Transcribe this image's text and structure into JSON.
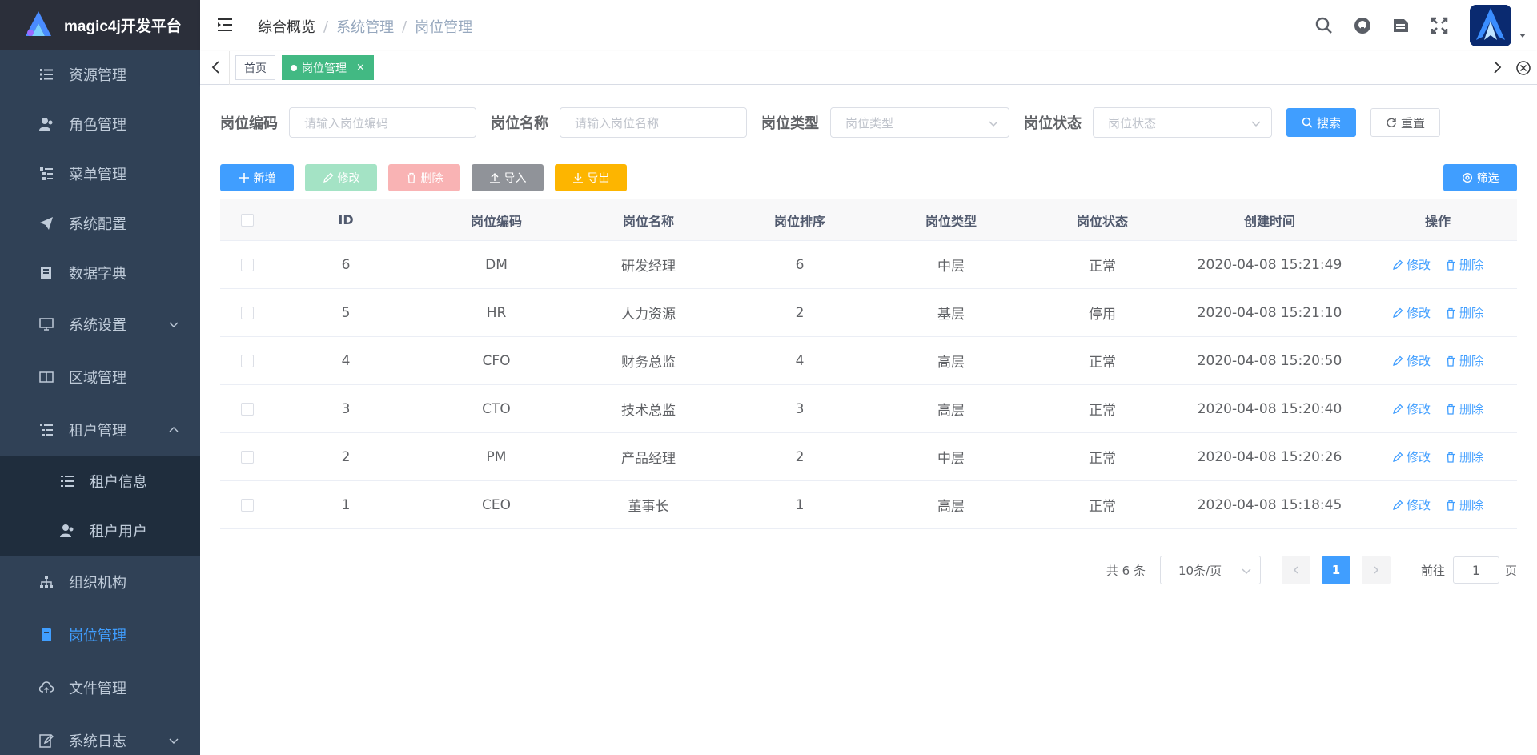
{
  "app": {
    "title": "magic4j开发平台"
  },
  "sidebar": {
    "items": [
      {
        "label": "资源管理",
        "icon": "resource-list-icon"
      },
      {
        "label": "角色管理",
        "icon": "user-role-icon"
      },
      {
        "label": "菜单管理",
        "icon": "menu-tree-icon"
      },
      {
        "label": "系统配置",
        "icon": "paper-plane-icon"
      },
      {
        "label": "数据字典",
        "icon": "book-icon"
      },
      {
        "label": "系统设置",
        "icon": "monitor-icon",
        "expandable": true,
        "expanded": false
      },
      {
        "label": "区域管理",
        "icon": "columns-icon"
      },
      {
        "label": "租户管理",
        "icon": "list-tree-icon",
        "expandable": true,
        "expanded": true
      },
      {
        "label": "租户信息",
        "icon": "list-icon",
        "sub": true
      },
      {
        "label": "租户用户",
        "icon": "user-group-icon",
        "sub": true
      },
      {
        "label": "组织机构",
        "icon": "org-chart-icon"
      },
      {
        "label": "岗位管理",
        "icon": "post-card-icon",
        "active": true
      },
      {
        "label": "文件管理",
        "icon": "cloud-upload-icon"
      },
      {
        "label": "系统日志",
        "icon": "log-edit-icon",
        "expandable": true,
        "expanded": false
      }
    ]
  },
  "navbar": {
    "breadcrumb": [
      "综合概览",
      "系统管理",
      "岗位管理"
    ],
    "icons": [
      "search-icon",
      "github-icon",
      "document-icon",
      "fullscreen-icon"
    ]
  },
  "tags": {
    "home": "首页",
    "current": "岗位管理",
    "close": "×"
  },
  "search": {
    "code_label": "岗位编码",
    "code_placeholder": "请输入岗位编码",
    "name_label": "岗位名称",
    "name_placeholder": "请输入岗位名称",
    "type_label": "岗位类型",
    "type_placeholder": "岗位类型",
    "status_label": "岗位状态",
    "status_placeholder": "岗位状态",
    "search_btn": "搜索",
    "reset_btn": "重置"
  },
  "toolbar": {
    "add": "新增",
    "edit": "修改",
    "delete": "删除",
    "import": "导入",
    "export": "导出",
    "filter": "筛选"
  },
  "table": {
    "headers": [
      "ID",
      "岗位编码",
      "岗位名称",
      "岗位排序",
      "岗位类型",
      "岗位状态",
      "创建时间",
      "操作"
    ],
    "edit_label": "修改",
    "delete_label": "删除",
    "rows": [
      {
        "id": "6",
        "code": "DM",
        "name": "研发经理",
        "sort": "6",
        "type": "中层",
        "status": "正常",
        "time": "2020-04-08 15:21:49"
      },
      {
        "id": "5",
        "code": "HR",
        "name": "人力资源",
        "sort": "2",
        "type": "基层",
        "status": "停用",
        "time": "2020-04-08 15:21:10"
      },
      {
        "id": "4",
        "code": "CFO",
        "name": "财务总监",
        "sort": "4",
        "type": "高层",
        "status": "正常",
        "time": "2020-04-08 15:20:50"
      },
      {
        "id": "3",
        "code": "CTO",
        "name": "技术总监",
        "sort": "3",
        "type": "高层",
        "status": "正常",
        "time": "2020-04-08 15:20:40"
      },
      {
        "id": "2",
        "code": "PM",
        "name": "产品经理",
        "sort": "2",
        "type": "中层",
        "status": "正常",
        "time": "2020-04-08 15:20:26"
      },
      {
        "id": "1",
        "code": "CEO",
        "name": "董事长",
        "sort": "1",
        "type": "高层",
        "status": "正常",
        "time": "2020-04-08 15:18:45"
      }
    ]
  },
  "pagination": {
    "total": "共 6 条",
    "page_size": "10条/页",
    "current": "1",
    "goto_prefix": "前往",
    "goto_value": "1",
    "goto_suffix": "页"
  },
  "colors": {
    "sidebar_bg": "#304156",
    "primary": "#409eff",
    "success_tag": "#42b983",
    "warning": "#fdb500"
  }
}
